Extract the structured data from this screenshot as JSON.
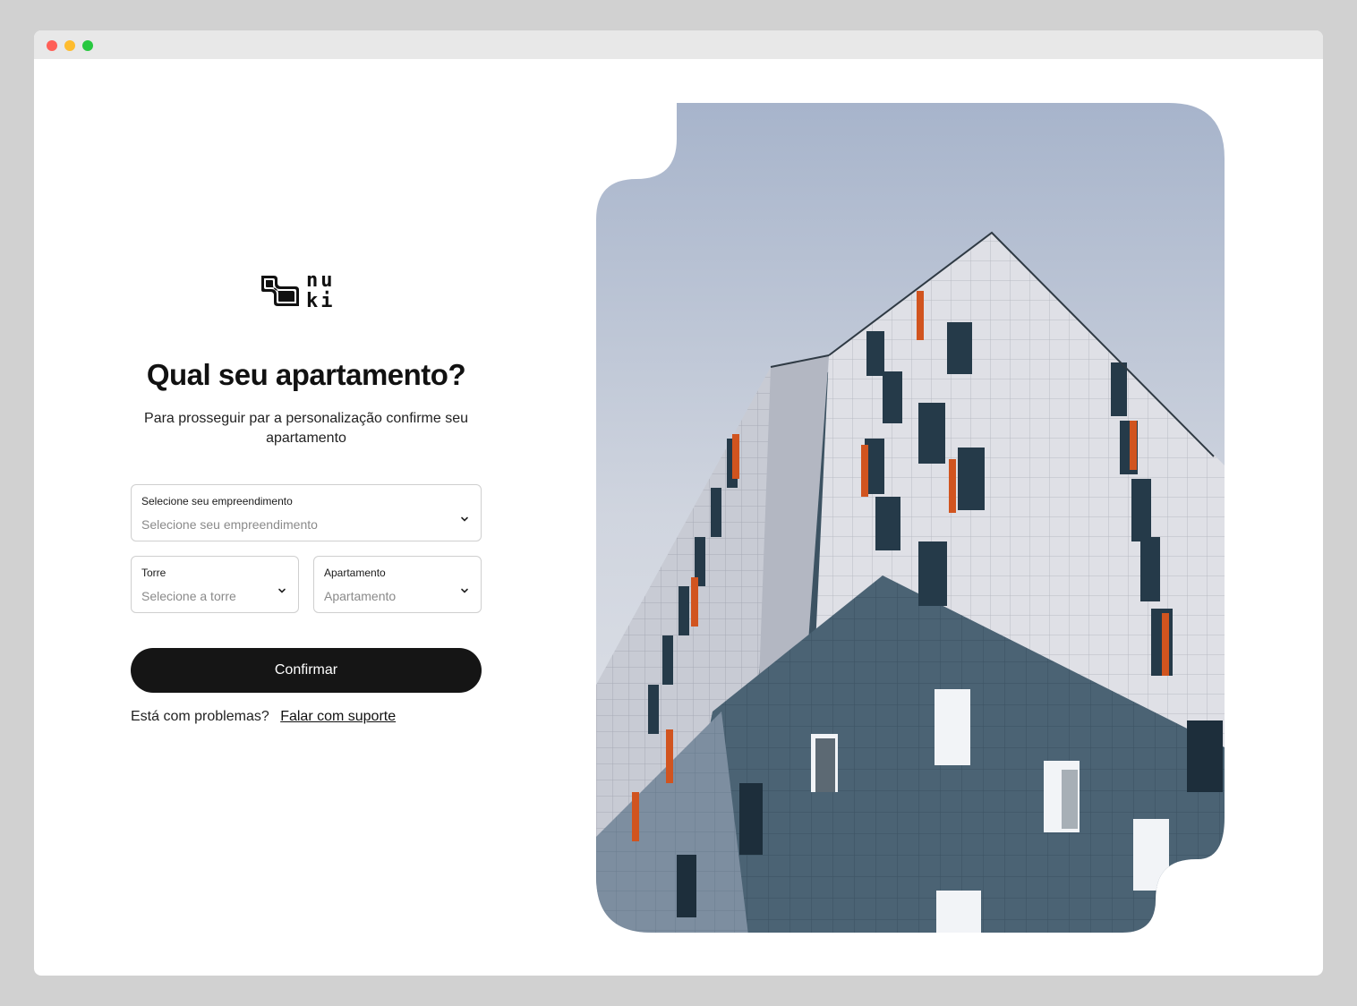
{
  "window": {
    "controls": [
      "close",
      "minimize",
      "maximize"
    ]
  },
  "brand": {
    "logo_line1": "nu",
    "logo_line2": "ki"
  },
  "page": {
    "title": "Qual seu apartamento?",
    "subtitle": "Para prosseguir par a personalização confirme seu apartamento"
  },
  "form": {
    "empreendimento": {
      "label": "Selecione seu empreendimento",
      "value": "Selecione seu empreendimento"
    },
    "torre": {
      "label": "Torre",
      "value": "Selecione a torre"
    },
    "apartamento": {
      "label": "Apartamento",
      "value": "Apartamento"
    },
    "confirm_label": "Confirmar"
  },
  "help": {
    "prompt": "Está com problemas?",
    "link_label": "Falar com suporte"
  },
  "colors": {
    "button_bg": "#151515",
    "sky": "#a9b6cc",
    "accent_orange": "#d1541f",
    "facade_dark": "#3e5667"
  },
  "hero": {
    "subject": "modern apartment building"
  }
}
